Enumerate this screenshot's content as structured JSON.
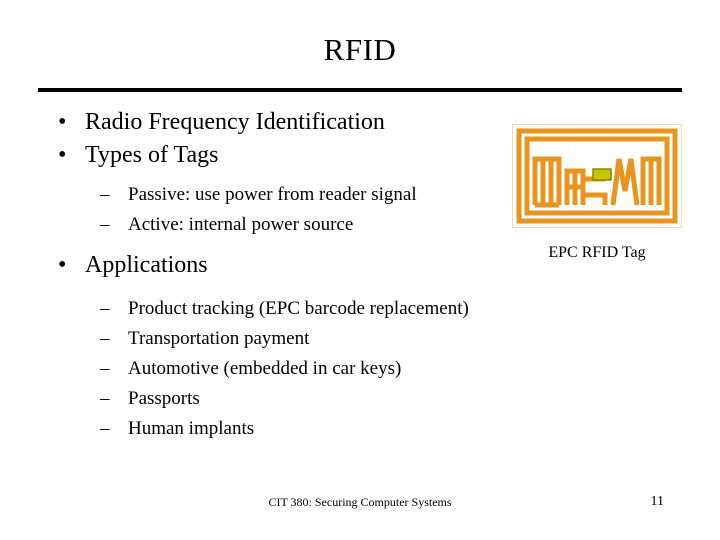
{
  "slide": {
    "title": "RFID",
    "bullets": [
      {
        "level": 1,
        "marker": "•",
        "text": "Radio Frequency Identification"
      },
      {
        "level": 1,
        "marker": "•",
        "text": "Types of Tags"
      },
      {
        "level": 2,
        "marker": "–",
        "text": "Passive: use power from reader signal"
      },
      {
        "level": 2,
        "marker": "–",
        "text": "Active: internal power source"
      },
      {
        "level": 1,
        "marker": "•",
        "text": "Applications"
      },
      {
        "level": 2,
        "marker": "–",
        "text": "Product tracking (EPC barcode replacement)"
      },
      {
        "level": 2,
        "marker": "–",
        "text": "Transportation payment"
      },
      {
        "level": 2,
        "marker": "–",
        "text": "Automotive (embedded in car keys)"
      },
      {
        "level": 2,
        "marker": "–",
        "text": "Passports"
      },
      {
        "level": 2,
        "marker": "–",
        "text": "Human implants"
      }
    ],
    "figure": {
      "caption": "EPC RFID Tag",
      "alt": "rfid-tag-antenna-image",
      "antenna_color": "#e8941e",
      "chip_color": "#b8b800",
      "substrate_color": "#ffffff"
    },
    "footer": {
      "course": "CIT 380: Securing Computer Systems",
      "page_number": "11"
    }
  }
}
